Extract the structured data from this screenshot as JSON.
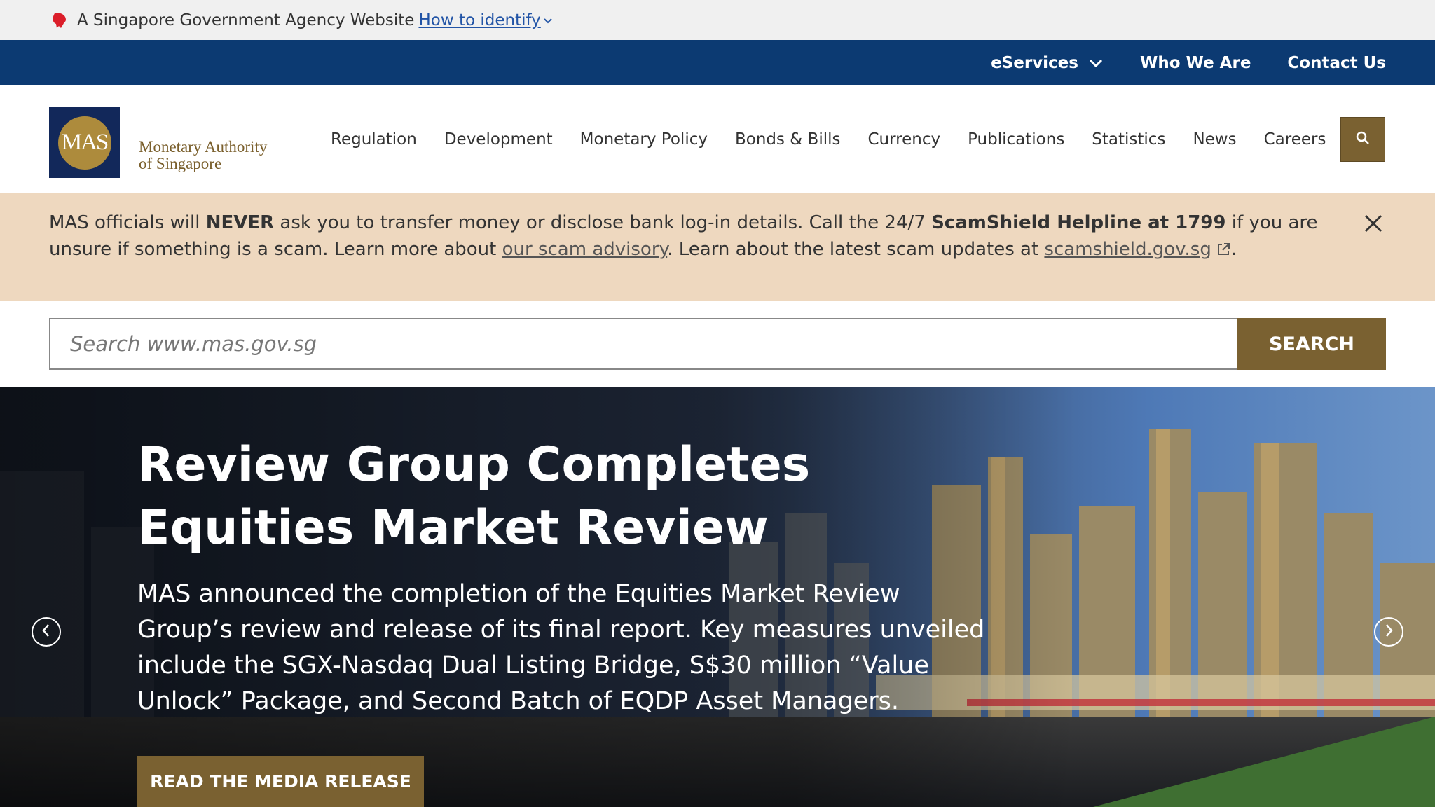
{
  "masthead": {
    "text": "A Singapore Government Agency Website",
    "link": "How to identify"
  },
  "utility_nav": {
    "items": [
      {
        "label": "eServices",
        "has_dropdown": true
      },
      {
        "label": "Who We Are"
      },
      {
        "label": "Contact Us"
      }
    ]
  },
  "header": {
    "logo_abbr": "MAS",
    "logo_name_line1": "Monetary Authority",
    "logo_name_line2": "of Singapore",
    "nav": [
      "Regulation",
      "Development",
      "Monetary Policy",
      "Bonds & Bills",
      "Currency",
      "Publications",
      "Statistics",
      "News",
      "Careers"
    ]
  },
  "alert": {
    "part1": "MAS officials will ",
    "bold1": "NEVER",
    "part2": " ask you to transfer money or disclose bank log-in details. Call the 24/7 ",
    "bold2": "ScamShield Helpline at 1799",
    "part3": " if you are unsure if something is a scam. Learn more about ",
    "link1": "our scam advisory",
    "part4": ". Learn about the latest scam updates at ",
    "link2": "scamshield.gov.sg",
    "part5": "."
  },
  "search": {
    "placeholder": "Search www.mas.gov.sg",
    "button": "SEARCH"
  },
  "hero": {
    "title": "Review Group Completes Equities Market Review",
    "description": "MAS announced the completion of the Equities Market Review Group’s review and release of its final report. Key measures unveiled include the SGX-Nasdaq Dual Listing Bridge, S$30 million “Value Unlock” Package, and Second Batch of EQDP Asset Managers.",
    "cta": "READ THE MEDIA RELEASE"
  },
  "colors": {
    "navy": "#0c3a72",
    "gold": "#7a6131",
    "alert_bg": "#eed8bf",
    "logo_navy": "#12285a"
  }
}
